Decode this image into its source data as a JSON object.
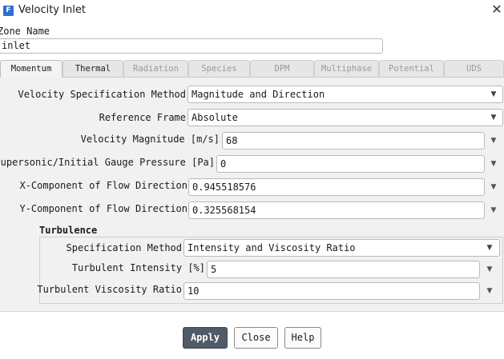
{
  "window": {
    "title": "Velocity Inlet",
    "app_icon": "F",
    "close_glyph": "✕"
  },
  "zone": {
    "label": "Zone Name",
    "value": "inlet"
  },
  "tabs": [
    {
      "label": "Momentum"
    },
    {
      "label": "Thermal"
    },
    {
      "label": "Radiation"
    },
    {
      "label": "Species"
    },
    {
      "label": "DPM"
    },
    {
      "label": "Multiphase"
    },
    {
      "label": "Potential"
    },
    {
      "label": "UDS"
    }
  ],
  "momentum": {
    "velocity_spec_method": {
      "label": "Velocity Specification Method",
      "value": "Magnitude and Direction"
    },
    "reference_frame": {
      "label": "Reference Frame",
      "value": "Absolute"
    },
    "velocity_magnitude": {
      "label": "Velocity Magnitude [m/s]",
      "value": "68"
    },
    "gauge_pressure": {
      "label": "Supersonic/Initial Gauge Pressure [Pa]",
      "value": "0"
    },
    "x_component": {
      "label": "X-Component of Flow Direction",
      "value": "0.945518576"
    },
    "y_component": {
      "label": "Y-Component of Flow Direction",
      "value": "0.325568154"
    }
  },
  "turbulence": {
    "heading": "Turbulence",
    "spec_method": {
      "label": "Specification Method",
      "value": "Intensity and Viscosity Ratio"
    },
    "intensity": {
      "label": "Turbulent Intensity [%]",
      "value": "5"
    },
    "viscosity_ratio": {
      "label": "Turbulent Viscosity Ratio",
      "value": "10"
    }
  },
  "buttons": {
    "apply": "Apply",
    "close": "Close",
    "help": "Help"
  },
  "icons": {
    "dropdown": "chevron-down-icon",
    "close": "close-icon"
  }
}
